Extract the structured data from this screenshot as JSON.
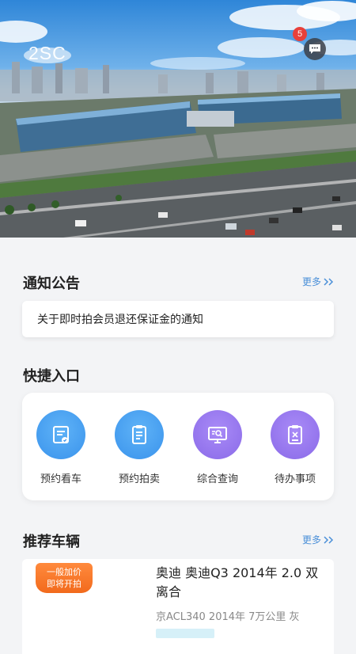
{
  "header": {
    "brand": "2SC",
    "message_badge": "5",
    "message_icon": "chat-bubble-icon"
  },
  "notice": {
    "title": "通知公告",
    "more_label": "更多",
    "items": [
      {
        "text": "关于即时拍会员退还保证金的通知"
      }
    ]
  },
  "shortcuts": {
    "title": "快捷入口",
    "items": [
      {
        "label": "预约看车",
        "icon": "car-booking-icon",
        "color": "#3a93ec"
      },
      {
        "label": "预约拍卖",
        "icon": "auction-list-icon",
        "color": "#3a93ec"
      },
      {
        "label": "综合查询",
        "icon": "monitor-search-icon",
        "color": "#8a6ae8"
      },
      {
        "label": "待办事项",
        "icon": "clipboard-todo-icon",
        "color": "#8a6ae8"
      }
    ]
  },
  "recommended": {
    "title": "推荐车辆",
    "more_label": "更多",
    "cars": [
      {
        "tag_line1": "一般加价",
        "tag_line2": "即将开拍",
        "title": "奥迪 奥迪Q3 2014年 2.0 双离合",
        "subtitle": "京ACL340 2014年 7万公里 灰"
      }
    ]
  },
  "colors": {
    "accent_blue": "#4a8fd8",
    "tag_orange": "#f26a1c",
    "badge_red": "#e8403a"
  }
}
